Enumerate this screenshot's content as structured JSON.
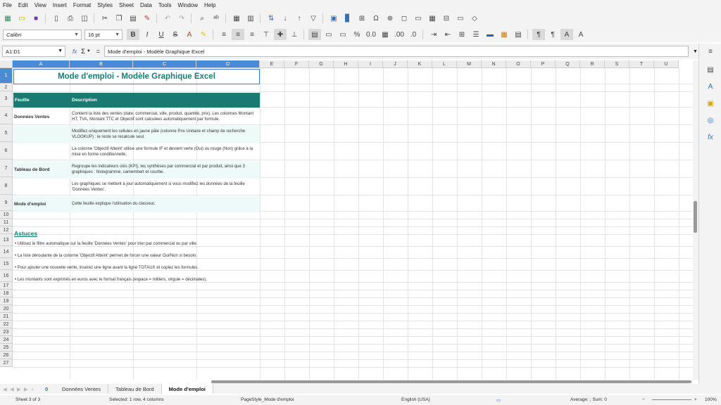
{
  "menu": [
    "File",
    "Edit",
    "View",
    "Insert",
    "Format",
    "Styles",
    "Sheet",
    "Data",
    "Tools",
    "Window",
    "Help"
  ],
  "toolbar": {
    "font_name": "Calibri",
    "font_size": "16 pt"
  },
  "formula": {
    "cell_ref": "A1:D1",
    "fx": "fx",
    "sigma": "Σ",
    "equals": "=",
    "content": "Mode d'emploi - Modèle Graphique Excel"
  },
  "columns": [
    "A",
    "B",
    "C",
    "D",
    "E",
    "F",
    "G",
    "H",
    "I",
    "J",
    "K",
    "L",
    "M",
    "N",
    "O",
    "P",
    "Q",
    "R",
    "S",
    "T",
    "U"
  ],
  "rows": [
    "1",
    "2",
    "3",
    "4",
    "5",
    "6",
    "7",
    "8",
    "9",
    "10",
    "11",
    "12",
    "13",
    "14",
    "15",
    "16",
    "17",
    "18",
    "19",
    "20",
    "21",
    "22",
    "23",
    "24",
    "25",
    "26",
    "27"
  ],
  "sheet": {
    "title": "Mode d'emploi - Modèle Graphique Excel",
    "header_feuille": "Feuille",
    "header_description": "Description",
    "entries": [
      {
        "sheet": "Données Ventes",
        "text": "Contient la liste des ventes (date, commercial, ville, produit, quantité, prix). Les colonnes Montant HT, TVA, Montant TTC et Objectif sont calculées automatiquement par formule."
      },
      {
        "sheet": "",
        "text": "Modifiez uniquement les cellules en jaune pâle (colonne Prix Unitaire et champ de recherche VLOOKUP) : le reste se recalcule seul."
      },
      {
        "sheet": "",
        "text": "La colonne 'Objectif Atteint' utilise une formule IF et devient verte (Oui) ou rouge (Non) grâce à la mise en forme conditionnelle."
      },
      {
        "sheet": "Tableau de Bord",
        "text": "Regroupe les indicateurs clés (KPI), les synthèses par commercial et par produit, ainsi que 3 graphiques : histogramme, camembert et courbe."
      },
      {
        "sheet": "",
        "text": "Les graphiques se mettent à jour automatiquement si vous modifiez les données de la feuille 'Données Ventes'."
      },
      {
        "sheet": "Mode d'emploi",
        "text": "Cette feuille explique l'utilisation du classeur."
      }
    ],
    "tips_title": "Astuces",
    "tips": [
      "• Utilisez le filtre automatique sur la feuille 'Données Ventes' pour trier par commercial ou par ville.",
      "• La liste déroulante de la colonne 'Objectif Atteint' permet de forcer une valeur Oui/Non si besoin.",
      "• Pour ajouter une nouvelle vente, insérez une ligne avant la ligne TOTAUX et copiez les formules.",
      "• Les montants sont exprimés en euros avec le format français (espace = milliers, virgule = décimales)."
    ]
  },
  "tabs": [
    "Données Ventes",
    "Tableau de Bord",
    "Mode d'emploi"
  ],
  "tab_nav_label": "0",
  "status": {
    "sheet": "Sheet 3 of 3",
    "selection": "Selected: 1 row, 4 columns",
    "page_style": "PageStyle_Mode d'emploi",
    "language": "English (USA)",
    "summary": "Average: ; Sum: 0",
    "zoom": "100%"
  },
  "colors": {
    "header_teal": "#1a7a72",
    "band": "#eefaf8",
    "selection": "#4a8ad6"
  }
}
